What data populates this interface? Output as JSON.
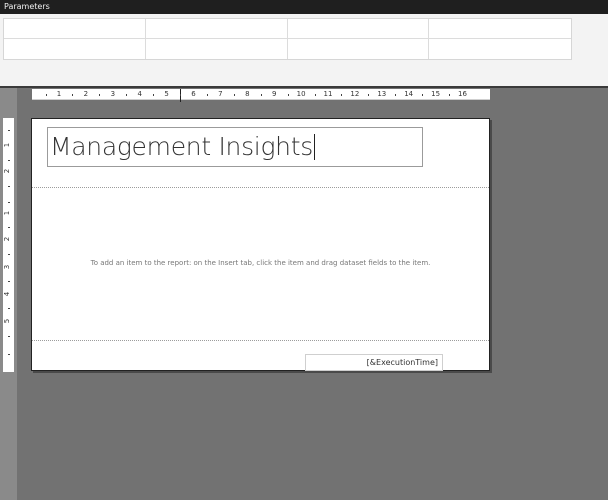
{
  "params": {
    "title": "Parameters"
  },
  "ruler": {
    "h_numbers": [
      "1",
      "2",
      "3",
      "4",
      "5",
      "6",
      "7",
      "8",
      "9",
      "10",
      "11",
      "12",
      "13",
      "14",
      "15",
      "16"
    ],
    "v_numbers": [
      "1",
      "2",
      "1",
      "2",
      "3",
      "4",
      "5"
    ]
  },
  "report": {
    "title": "Management Insights",
    "hint": "To add an item to the report: on the Insert tab, click the item and drag dataset fields to the item.",
    "footer_expression": "[&ExecutionTime]"
  }
}
